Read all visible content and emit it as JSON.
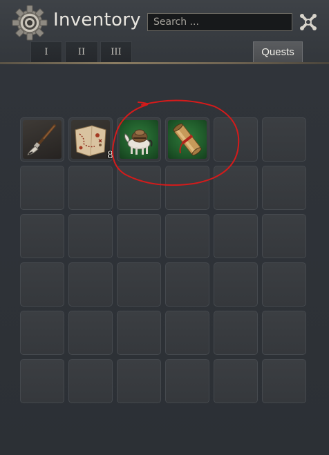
{
  "header": {
    "title": "Inventory",
    "search_placeholder": "Search ...",
    "tabs": [
      {
        "label": "I"
      },
      {
        "label": "II"
      },
      {
        "label": "III"
      }
    ],
    "quests_label": "Quests"
  },
  "inventory": {
    "items": [
      {
        "icon": "paintbrush-icon",
        "count": ""
      },
      {
        "icon": "treasure-map-icon",
        "count": "8"
      },
      {
        "icon": "pack-horse-icon",
        "count": ""
      },
      {
        "icon": "scroll-icon",
        "count": ""
      }
    ]
  },
  "colors": {
    "title_text": "#e9e6df",
    "annotation": "#d41b1b",
    "quest_item_bg": "#1f5a2a"
  }
}
